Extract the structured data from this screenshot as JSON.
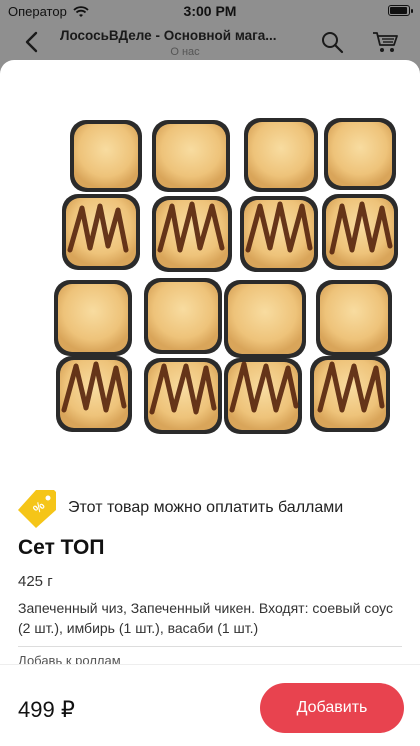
{
  "status_bar": {
    "carrier": "Оператор",
    "time": "3:00 PM"
  },
  "nav": {
    "title": "ЛососьВДеле - Основной мага...",
    "subtitle": "О нас"
  },
  "product": {
    "points_message": "Этот товар можно оплатить баллами",
    "name": "Сет ТОП",
    "weight": "425 г",
    "description": "Запеченный чиз, Запеченный чикен. Входят: соевый соус (2 шт.), имбирь (1 шт.), васаби (1 шт.)",
    "addons_label": "Добавь к роллам",
    "price": "499 ₽"
  },
  "actions": {
    "add_label": "Добавить"
  },
  "colors": {
    "accent": "#e8434f",
    "tag": "#f5c518"
  }
}
